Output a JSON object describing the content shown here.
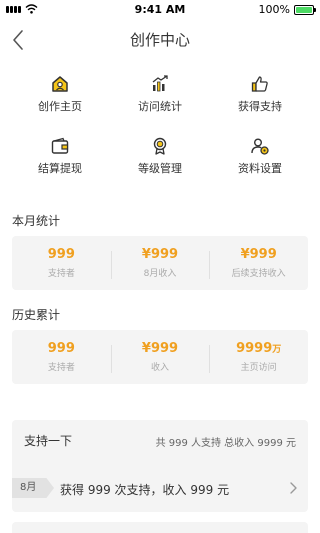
{
  "status_bar": {
    "time": "9:41 AM",
    "battery": "100%"
  },
  "header": {
    "title": "创作中心"
  },
  "menu": [
    {
      "label": "创作主页",
      "icon": "home-profile-icon"
    },
    {
      "label": "访问统计",
      "icon": "chart-icon"
    },
    {
      "label": "获得支持",
      "icon": "thumbs-up-icon"
    },
    {
      "label": "结算提现",
      "icon": "wallet-icon"
    },
    {
      "label": "等级管理",
      "icon": "badge-icon"
    },
    {
      "label": "资料设置",
      "icon": "profile-settings-icon"
    }
  ],
  "monthly": {
    "title": "本月统计",
    "stats": [
      {
        "value": "999",
        "label": "支持者"
      },
      {
        "value": "¥999",
        "label": "8月收入"
      },
      {
        "value": "¥999",
        "label": "后续支持收入"
      }
    ]
  },
  "history": {
    "title": "历史累计",
    "stats": [
      {
        "value": "999",
        "label": "支持者"
      },
      {
        "value": "¥999",
        "label": "收入"
      },
      {
        "value": "9999",
        "unit": "万",
        "label": "主页访问"
      }
    ]
  },
  "support": {
    "title": "支持一下",
    "summary": "共 999 人支持  总收入 9999 元",
    "row": {
      "month": "8月",
      "text": "获得 999 次支持，收入 999 元"
    }
  },
  "colors": {
    "accent": "#f0a020",
    "icon_yellow": "#f5c518",
    "card_bg": "#f4f4f4"
  }
}
